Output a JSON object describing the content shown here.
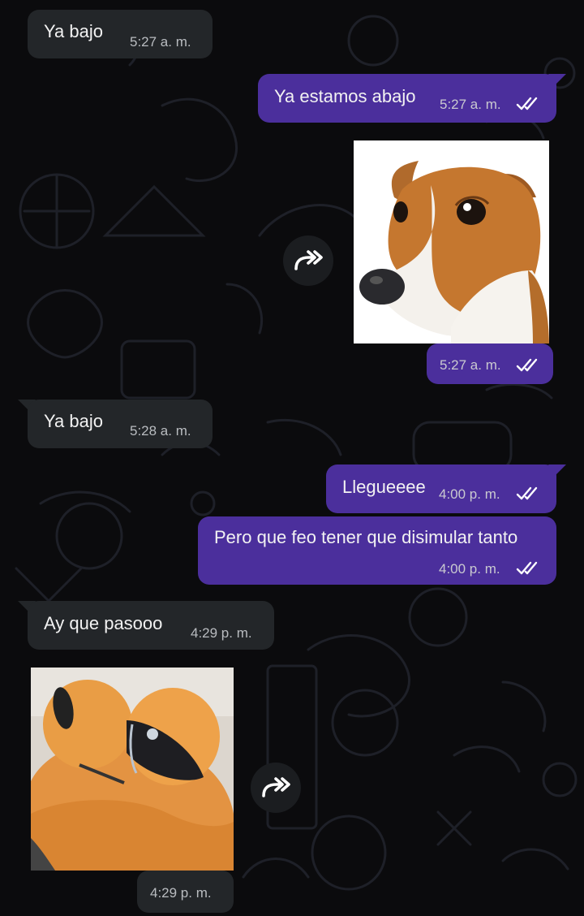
{
  "messages": [
    {
      "id": "m1",
      "direction": "in",
      "text": "Ya bajo",
      "time": "5:27 a. m."
    },
    {
      "id": "m2",
      "direction": "out",
      "text": "Ya estamos abajo",
      "time": "5:27 a. m.",
      "status": "read"
    },
    {
      "id": "m3",
      "direction": "out",
      "type": "image",
      "image": "dog-photo",
      "time": "5:27 a. m.",
      "status": "read"
    },
    {
      "id": "m4",
      "direction": "in",
      "text": "Ya bajo",
      "time": "5:28 a. m."
    },
    {
      "id": "m5",
      "direction": "out",
      "text": "Llegueeee",
      "time": "4:00 p. m.",
      "status": "read"
    },
    {
      "id": "m6",
      "direction": "out",
      "text": "Pero que feo tener que disimular tanto",
      "time": "4:00 p. m.",
      "status": "read"
    },
    {
      "id": "m7",
      "direction": "in",
      "text": "Ay que pasooo",
      "time": "4:29 p. m."
    },
    {
      "id": "m8",
      "direction": "in",
      "type": "image",
      "image": "orange-figure-photo",
      "time": "4:29 p. m."
    }
  ],
  "icons": {
    "forward": "forward-arrow-icon",
    "read_status": "double-check-icon"
  },
  "colors": {
    "background": "#0b0b0d",
    "incoming_bubble": "#232629",
    "outgoing_bubble": "#4b2f9c",
    "read_ticks": "#ffffff"
  }
}
